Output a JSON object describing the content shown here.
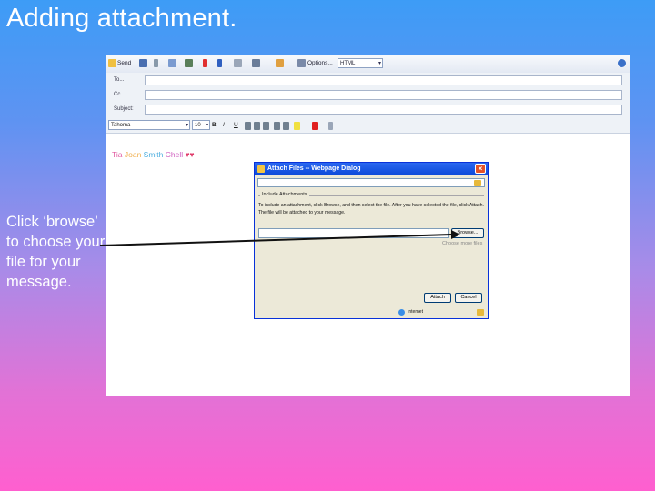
{
  "slide": {
    "title": "Adding attachment.",
    "caption": "Click ‘browse’ to choose your file for your message."
  },
  "toolbar": {
    "send": "Send",
    "options": "Options...",
    "format_value": "HTML"
  },
  "fields": [
    {
      "label": "To..."
    },
    {
      "label": "Cc..."
    },
    {
      "label": "Subject:"
    }
  ],
  "format_bar": {
    "font": "Tahoma",
    "size": "10",
    "bold": "B",
    "italic": "I",
    "underline": "U"
  },
  "signature": [
    {
      "text": "Tia",
      "color": "#e05aa0"
    },
    {
      "text": " Joan",
      "color": "#f0b050"
    },
    {
      "text": " Smith",
      "color": "#50b0e0"
    },
    {
      "text": " Chell",
      "color": "#d060c0"
    },
    {
      "text": " ♥♥",
      "color": "#e03a6a"
    }
  ],
  "dialog": {
    "title": "Attach Files -- Webpage Dialog",
    "close": "×",
    "group_label": "Include Attachments",
    "instructions": "To include an attachment, click Browse, and then select the file. After you have selected the file, click Attach. The file will be attached to your message.",
    "browse": "Browse...",
    "link": "Choose more files",
    "attach": "Attach",
    "cancel": "Cancel",
    "status_zone": "Internet"
  }
}
